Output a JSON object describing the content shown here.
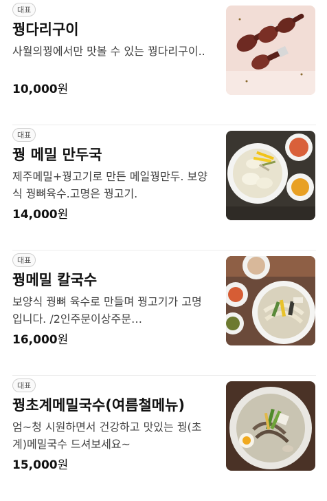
{
  "menu_items": [
    {
      "badge": "대표",
      "name": "꿩다리구이",
      "description": "사월의꿩에서만 맛볼 수 있는 꿩다리구이..",
      "price_amount": "10,000",
      "price_unit": "원",
      "image": "grilled-pheasant-legs-photo"
    },
    {
      "badge": "대표",
      "name": "꿩 메밀 만두국",
      "description": "제주메밀+꿩고기로 만든 메일꿩만두. 보양식 꿩뼈육수.고명은 꿩고기.",
      "price_amount": "14,000",
      "price_unit": "원",
      "image": "buckwheat-dumpling-soup-photo"
    },
    {
      "badge": "대표",
      "name": "꿩메밀 칼국수",
      "description": "보양식 꿩뼈 육수로 만들며 꿩고기가 고명입니다. /2인주문이상주문…",
      "price_amount": "16,000",
      "price_unit": "원",
      "image": "buckwheat-kalguksu-photo"
    },
    {
      "badge": "대표",
      "name": "꿩초계메밀국수(여름철메뉴)",
      "description": "엄~청 시원하면서 건강하고 맛있는 꿩(초계)메밀국수 드셔보세요~",
      "price_amount": "15,000",
      "price_unit": "원",
      "image": "cold-buckwheat-noodle-photo"
    }
  ]
}
